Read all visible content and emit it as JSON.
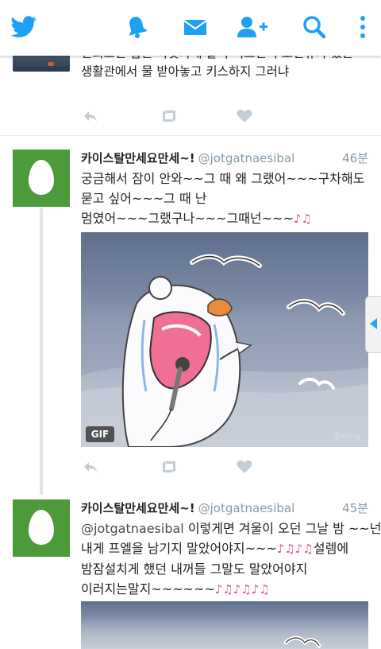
{
  "topbar": {
    "icons": [
      "twitter-logo-icon",
      "bell-icon",
      "mail-icon",
      "add-user-icon",
      "search-icon",
      "more-vertical-icon"
    ],
    "accent": "#1da1f2"
  },
  "prev_tweet": {
    "lines": [
      "면회오면 잡은 바닷가재 같이 먹으면서 오선뷰가 있는",
      "생활관에서 물 받아놓고 키스하지 그러냐"
    ]
  },
  "tweets": [
    {
      "name": "카이스탈만세요만세~!",
      "handle": "@jotgatnaesibal",
      "time": "46분",
      "lines": [
        "궁금해서 잠이 안와~~그 때 왜 그랬어~~~구차해도",
        "묻고 싶어~~~그 때 난",
        "멈였어~~~그랬구나~~~그때넌~~~"
      ],
      "notes": "♪♫",
      "media": {
        "badge": "GIF",
        "watermark": "@kong"
      }
    },
    {
      "name": "카이스탈만세요만세~!",
      "handle": "@jotgatnaesibal",
      "time": "45분",
      "mention": "@jotgatnaesibal",
      "lines": [
        "이렇게면 겨울이 오던 그날 밤 ~~넌",
        "내게 프엘을 남기지 말았어야지~~~",
        "밤잠설치게 했던 내꺼들 그말도 말았어야지",
        "이러지는말지~~~~~~"
      ],
      "notes": [
        "♪♫♪♫",
        "♪♫♪♫♪♫"
      ],
      "line2_suffix": "설렘에"
    }
  ]
}
